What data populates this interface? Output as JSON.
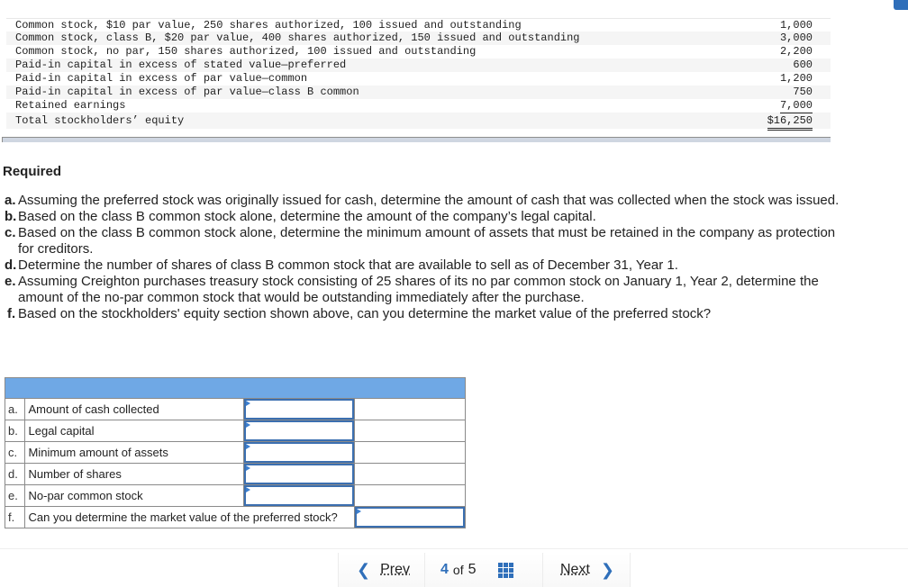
{
  "equity": {
    "rows": [
      {
        "label": "Common stock, $10 par value, 250 shares authorized, 100 issued and outstanding",
        "amount": "1,000"
      },
      {
        "label": "Common stock, class B, $20 par value, 400 shares authorized, 150 issued and outstanding",
        "amount": "3,000"
      },
      {
        "label": "Common stock, no par, 150 shares authorized, 100 issued and outstanding",
        "amount": "2,200"
      },
      {
        "label": "Paid-in capital in excess of stated value—preferred",
        "amount": "600"
      },
      {
        "label": "Paid-in capital in excess of par value—common",
        "amount": "1,200"
      },
      {
        "label": "Paid-in capital in excess of par value—class B common",
        "amount": "750"
      },
      {
        "label": "Retained earnings",
        "amount": "7,000"
      },
      {
        "label": "Total stockholders’ equity",
        "amount": "$16,250"
      }
    ]
  },
  "required": {
    "title": "Required",
    "items": [
      {
        "letter": "a.",
        "text": "Assuming the preferred stock was originally issued for cash, determine the amount of cash that was collected when the stock was issued."
      },
      {
        "letter": "b.",
        "text": "Based on the class B common stock alone, determine the amount of the company’s legal capital."
      },
      {
        "letter": "c.",
        "text": "Based on the class B common stock alone, determine the minimum amount of assets that must be retained in the company as protection for creditors."
      },
      {
        "letter": "d.",
        "text": "Determine the number of shares of class B common stock that are available to sell as of December 31, Year 1."
      },
      {
        "letter": "e.",
        "text": "Assuming Creighton purchases treasury stock consisting of 25 shares of its no par common stock on January 1, Year 2, determine the amount of the no-par common stock that would be outstanding immediately after the purchase."
      },
      {
        "letter": "f.",
        "text": "Based on the stockholders' equity section shown above, can you determine the market value of the preferred stock?"
      }
    ]
  },
  "answers": {
    "rows": [
      {
        "letter": "a.",
        "label": "Amount of cash collected",
        "value": ""
      },
      {
        "letter": "b.",
        "label": "Legal capital",
        "value": ""
      },
      {
        "letter": "c.",
        "label": "Minimum amount of assets",
        "value": ""
      },
      {
        "letter": "d.",
        "label": "Number of shares",
        "value": ""
      },
      {
        "letter": "e.",
        "label": "No-par common stock",
        "value": ""
      },
      {
        "letter": "f.",
        "label": "Can you determine the market value of the preferred stock?",
        "value": ""
      }
    ]
  },
  "pager": {
    "prev_label": "Prev",
    "current": "4",
    "of_label": "of",
    "total": "5",
    "next_label": "Next",
    "prev_icon": "chevron-left-icon",
    "next_icon": "chevron-right-icon",
    "grid_icon": "grid-icon"
  },
  "colors": {
    "accent": "#2f6fba",
    "table_header": "#6fa8e5",
    "input_border": "#3b6fb0"
  }
}
